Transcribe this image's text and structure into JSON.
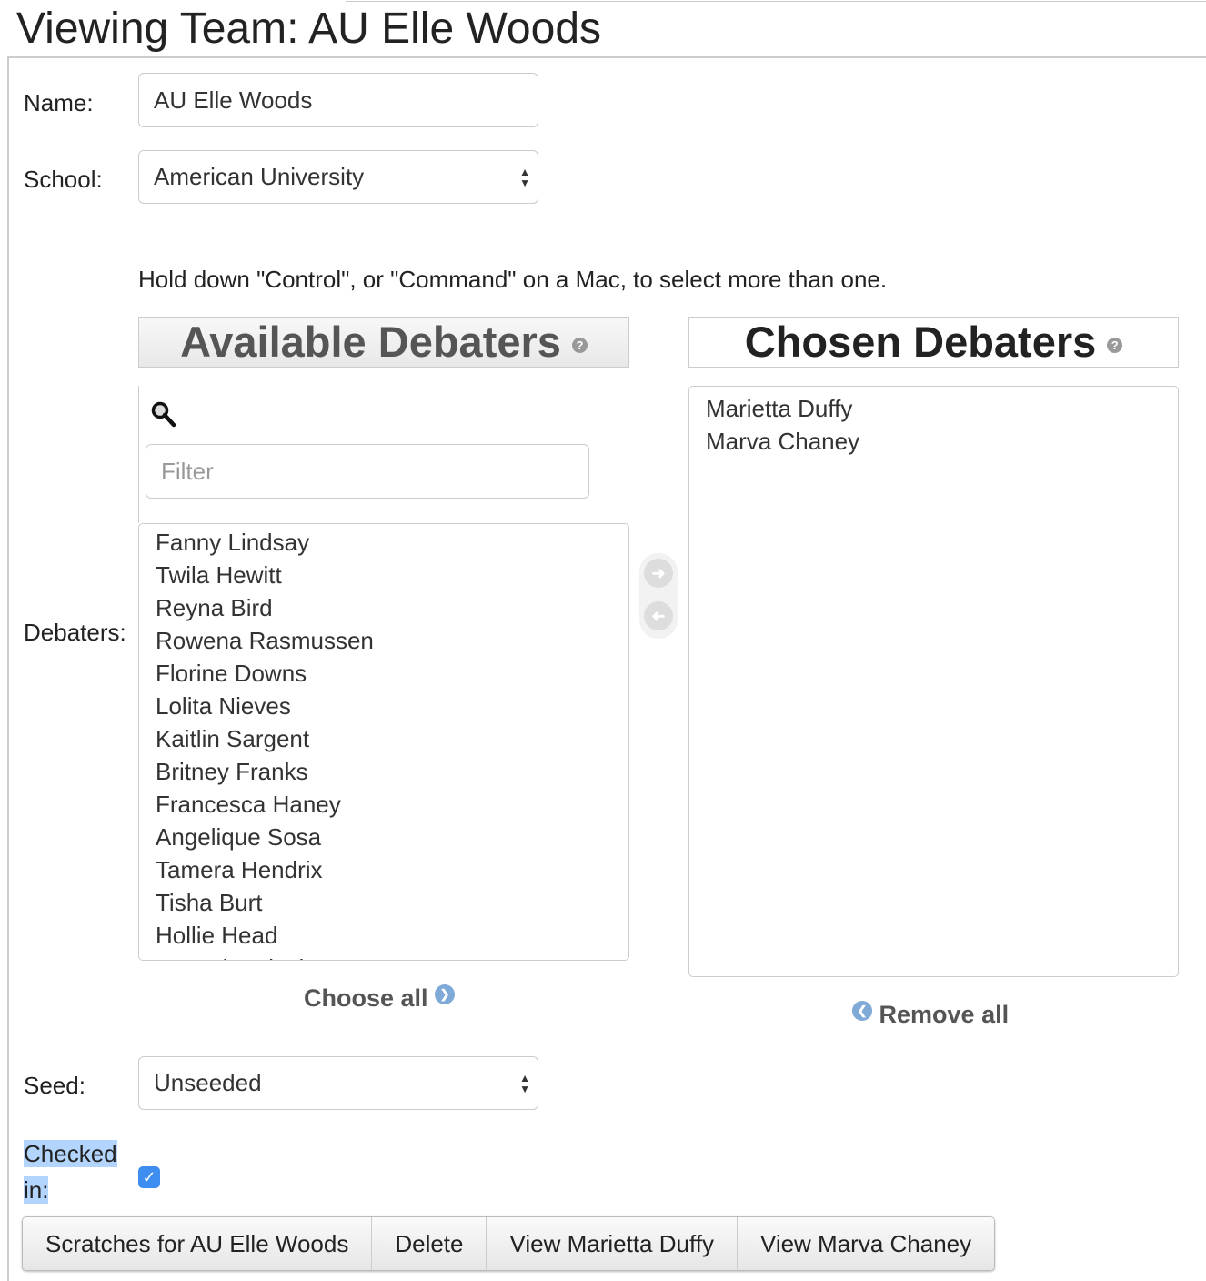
{
  "title": "Viewing Team: AU Elle Woods",
  "form": {
    "name_label": "Name:",
    "name_value": "AU Elle Woods",
    "school_label": "School:",
    "school_value": "American University",
    "help_text": "Hold down \"Control\", or \"Command\" on a Mac, to select more than one.",
    "debaters_label": "Debaters:",
    "available_title": "Available Debaters",
    "chosen_title": "Chosen Debaters",
    "filter_placeholder": "Filter",
    "available": [
      "Fanny Lindsay",
      "Twila Hewitt",
      "Reyna Bird",
      "Rowena Rasmussen",
      "Florine Downs",
      "Lolita Nieves",
      "Kaitlin Sargent",
      "Britney Franks",
      "Francesca Haney",
      "Angelique Sosa",
      "Tamera Hendrix",
      "Tisha Burt",
      "Hollie Head",
      "Marguita Finch"
    ],
    "chosen": [
      "Marietta Duffy",
      "Marva Chaney"
    ],
    "choose_all": "Choose all",
    "remove_all": "Remove all",
    "seed_label": "Seed:",
    "seed_value": "Unseeded",
    "checked_in_label": "Checked in:",
    "checked_in": true
  },
  "buttons": [
    "Scratches for AU Elle Woods",
    "Delete",
    "View Marietta Duffy",
    "View Marva Chaney"
  ],
  "colors": {
    "checkbox": "#3d8ef0",
    "selection": "#b3d4fc"
  }
}
